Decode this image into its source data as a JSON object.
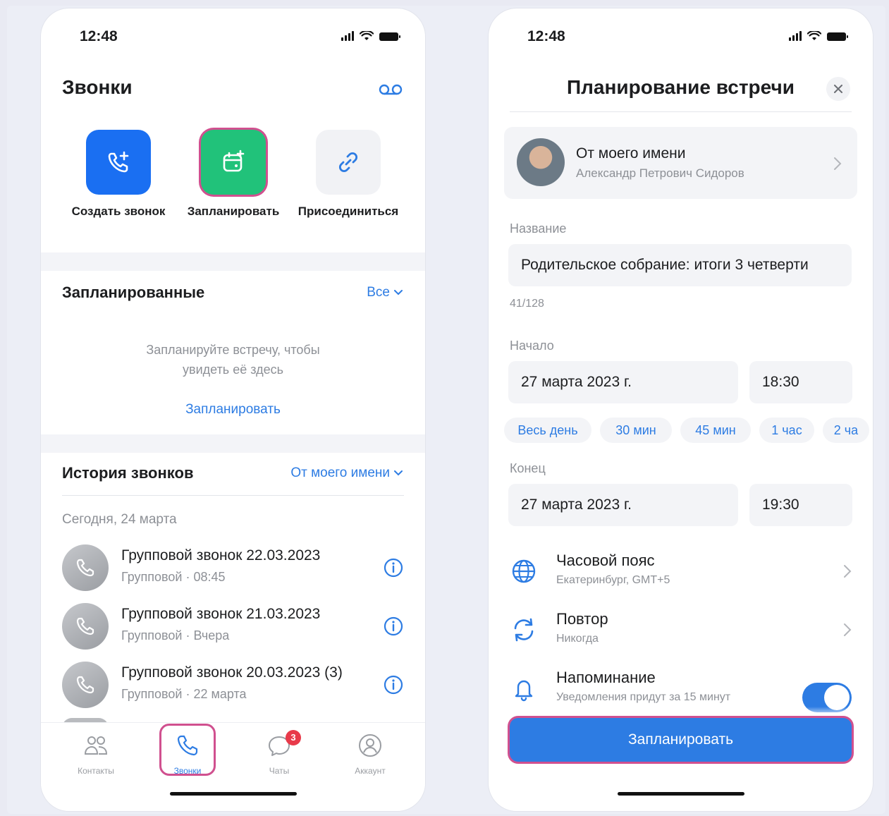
{
  "status_time": "12:48",
  "colors": {
    "accent": "#2d7ce3",
    "create_tile": "#1a6ff2",
    "schedule_tile": "#21c27a",
    "highlight": "#d0508f",
    "badge": "#e83a4a"
  },
  "left": {
    "title": "Звонки",
    "voicemail_icon": "voicemail-icon",
    "actions": [
      {
        "label": "Создать звонок",
        "icon": "phone-plus-icon"
      },
      {
        "label": "Запланировать",
        "icon": "calendar-plus-icon"
      },
      {
        "label": "Присоединиться",
        "icon": "link-icon"
      }
    ],
    "scheduled": {
      "title": "Запланированные",
      "filter": "Все",
      "empty_line1": "Запланируйте встречу, чтобы",
      "empty_line2": "увидеть её здесь",
      "empty_link": "Запланировать"
    },
    "history": {
      "title": "История звонков",
      "filter": "От моего имени",
      "day": "Сегодня, 24 марта",
      "calls": [
        {
          "title": "Групповой звонок 22.03.2023",
          "sub": "Групповой · 08:45"
        },
        {
          "title": "Групповой звонок 21.03.2023",
          "sub": "Групповой · Вчера"
        },
        {
          "title": "Групповой звонок 20.03.2023 (3)",
          "sub": "Групповой · 22 марта"
        }
      ]
    },
    "tabs": [
      {
        "label": "Контакты",
        "icon": "contacts-icon"
      },
      {
        "label": "Звонки",
        "icon": "phone-icon"
      },
      {
        "label": "Чаты",
        "icon": "chat-icon",
        "badge": "3"
      },
      {
        "label": "Аккаунт",
        "icon": "account-icon"
      }
    ]
  },
  "right": {
    "title": "Планирование встречи",
    "profile": {
      "name": "От моего имени",
      "sub": "Александр Петрович Сидоров"
    },
    "name_label": "Название",
    "name_value": "Родительское собрание: итоги 3 четверти",
    "counter": "41/128",
    "start_label": "Начало",
    "start_date": "27 марта 2023 г.",
    "start_time": "18:30",
    "durations": [
      "Весь день",
      "30 мин",
      "45 мин",
      "1 час",
      "2 ча"
    ],
    "end_label": "Конец",
    "end_date": "27 марта 2023 г.",
    "end_time": "19:30",
    "timezone": {
      "title": "Часовой пояс",
      "sub": "Екатеринбург, GMT+5"
    },
    "repeat": {
      "title": "Повтор",
      "sub": "Никогда"
    },
    "reminder": {
      "title": "Напоминание",
      "sub": "Уведомления придут за 15 минут",
      "enabled": true
    },
    "submit": "Запланировать"
  }
}
